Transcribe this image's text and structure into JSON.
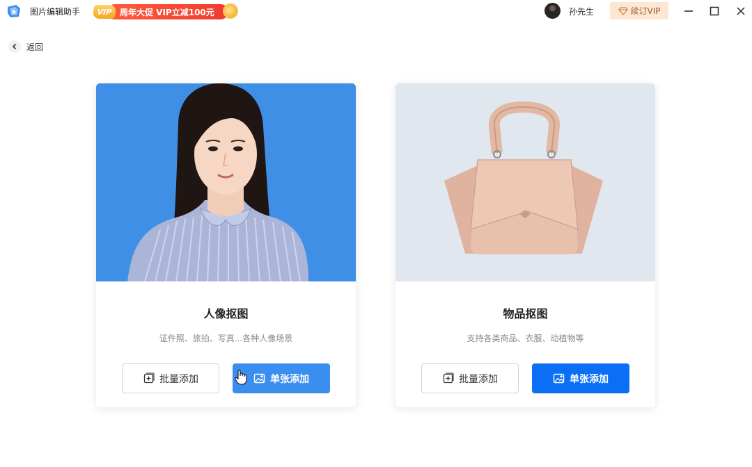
{
  "app": {
    "title": "图片编辑助手",
    "promo_tag": "VIP",
    "promo_text": "周年大促 VIP立减100元"
  },
  "user": {
    "name": "孙先生",
    "renew_label": "续订VIP"
  },
  "nav": {
    "back_label": "返回"
  },
  "cards": [
    {
      "title": "人像抠图",
      "desc": "证件照、旅拍、写真...各种人像场景",
      "batch_label": "批量添加",
      "single_label": "单张添加",
      "image_bg": "#3f8fe6"
    },
    {
      "title": "物品抠图",
      "desc": "支持各类商品、衣服、动植物等",
      "batch_label": "批量添加",
      "single_label": "单张添加",
      "image_bg": "#e1e7ee"
    }
  ],
  "colors": {
    "primary": "#0b6ff5",
    "primary_hover": "#3a8ef0",
    "promo_red": "#f23a2f",
    "vip_bg": "#fde7d3"
  }
}
